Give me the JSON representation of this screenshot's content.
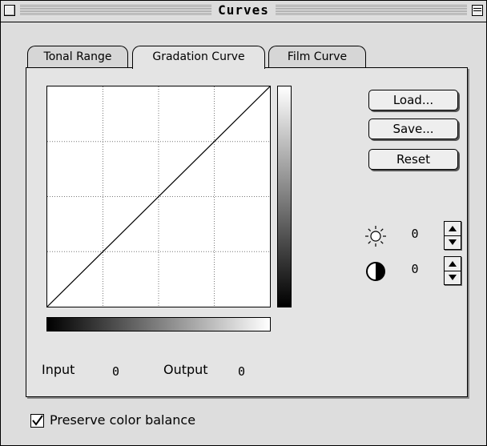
{
  "window": {
    "title": "Curves"
  },
  "tabs": [
    {
      "label": "Tonal Range",
      "active": false
    },
    {
      "label": "Gradation Curve",
      "active": true
    },
    {
      "label": "Film Curve",
      "active": false
    }
  ],
  "buttons": {
    "load": "Load...",
    "save": "Save...",
    "reset": "Reset"
  },
  "adjustments": {
    "brightness": {
      "icon": "sun-icon",
      "value": "0"
    },
    "contrast": {
      "icon": "contrast-icon",
      "value": "0"
    }
  },
  "readout": {
    "input_label": "Input",
    "input_value": "0",
    "output_label": "Output",
    "output_value": "0"
  },
  "options": {
    "preserve_color_balance_label": "Preserve color balance",
    "preserve_color_balance_checked": true
  },
  "curve": {
    "points": [
      [
        0,
        0
      ],
      [
        255,
        255
      ]
    ]
  }
}
